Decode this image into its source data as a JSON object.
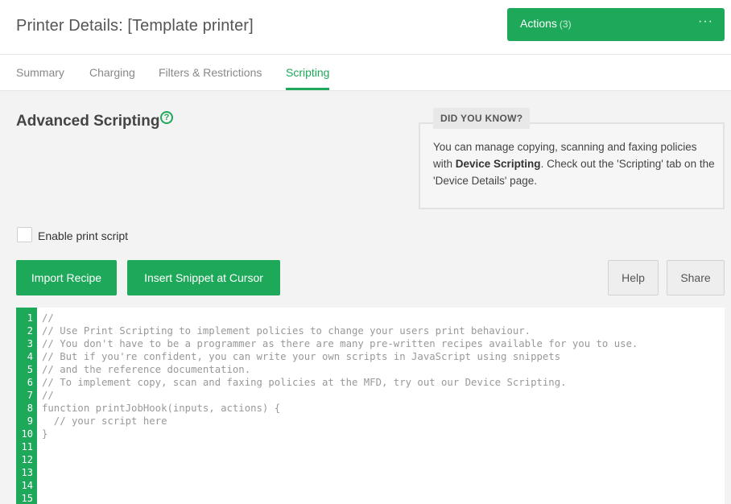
{
  "header": {
    "title": "Printer Details: [Template printer]",
    "actions_label": "Actions",
    "actions_count": "(3)",
    "actions_menu_icon": "ellipsis-icon"
  },
  "tabs": [
    {
      "label": "Summary"
    },
    {
      "label": "Charging"
    },
    {
      "label": "Filters & Restrictions"
    },
    {
      "label": "Scripting",
      "active": true
    }
  ],
  "section": {
    "title": "Advanced Scripting",
    "help_icon": "question-circle-icon",
    "help_glyph": "?"
  },
  "did_you_know": {
    "heading": "DID YOU KNOW?",
    "text_before": "You can manage copying, scanning and faxing policies with ",
    "text_bold": "Device Scripting",
    "text_after": ". Check out the 'Scripting' tab on the 'Device Details' page."
  },
  "enable_print_script": {
    "label": "Enable print script",
    "checked": false
  },
  "buttons": {
    "import_recipe": "Import Recipe",
    "insert_snippet": "Insert Snippet at Cursor",
    "help": "Help",
    "share": "Share"
  },
  "editor": {
    "line_numbers": [
      "1",
      "2",
      "3",
      "4",
      "5",
      "6",
      "7",
      "8",
      "9",
      "10",
      "11",
      "12",
      "13",
      "14",
      "15"
    ],
    "lines": [
      "//",
      "// Use Print Scripting to implement policies to change your users print behaviour.",
      "// You don't have to be a programmer as there are many pre-written recipes available for you to use.",
      "// But if you're confident, you can write your own scripts in JavaScript using snippets",
      "// and the reference documentation.",
      "// To implement copy, scan and faxing policies at the MFD, try out our Device Scripting.",
      "//",
      "function printJobHook(inputs, actions) {",
      "  // your script here",
      "}",
      "",
      "",
      "",
      "",
      ""
    ]
  },
  "colors": {
    "accent": "#1ea85a",
    "background": "#f3f3f3"
  }
}
